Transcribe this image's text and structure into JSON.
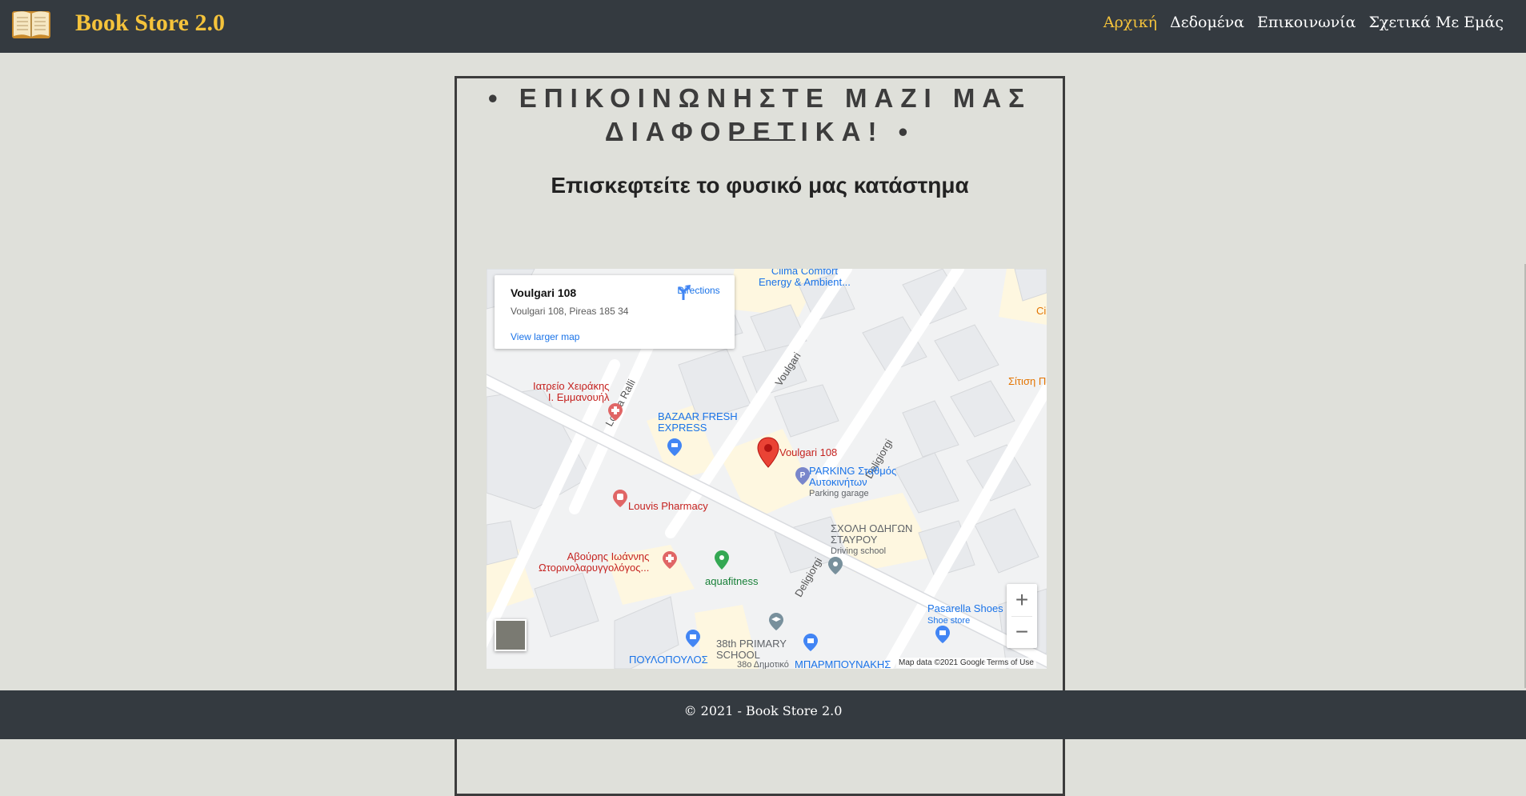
{
  "nav": {
    "brand": "Book Store 2.0",
    "links": [
      "Αρχική",
      "Δεδομένα",
      "Επικοινωνία",
      "Σχετικά Με Εμάς"
    ],
    "active": "Αρχική"
  },
  "contact": {
    "heading_line1": "• ΕΠΙΚΟΙΝΩΝΗΣΤΕ ΜΑΖΙ ΜΑΣ",
    "heading_line2": "ΔΙΑΦΟΡΕΤΙΚΑ! •",
    "subheading": "Επισκεφτείτε το φυσικό μας κατάστημα"
  },
  "map": {
    "card": {
      "title": "Voulgari 108",
      "address": "Voulgari 108, Pireas 185 34",
      "directions": "Directions",
      "larger_map": "View larger map"
    },
    "marker_label": "Voulgari 108",
    "streets": [
      "Voulgari",
      "Louka Ralli",
      "Deligiorgi",
      "Deligiorgi"
    ],
    "places": [
      {
        "name": "Ιατρείο Χειράκης\nΙ. Εμμανουήλ",
        "color": "#c5221f"
      },
      {
        "name": "BAZAAR FRESH\nEXPRESS",
        "color": "#1a73e8"
      },
      {
        "name": "PARKING Σταθμός\nΑυτοκινήτων",
        "color": "#1a73e8"
      },
      {
        "name": "Parking garage",
        "color": "#5f6368"
      },
      {
        "name": "Louvis Pharmacy",
        "color": "#c5221f"
      },
      {
        "name": "ΣΧΟΛΗ ΟΔΗΓΩΝ\nΣΤΑΥΡΟΥ",
        "color": "#5f6368"
      },
      {
        "name": "Driving school",
        "color": "#5f6368"
      },
      {
        "name": "Αβούρης Ιωάννης\nΩτορινολαρυγγολόγος...",
        "color": "#c5221f"
      },
      {
        "name": "aquafitness",
        "color": "#188038"
      },
      {
        "name": "Pasarella Shoes",
        "color": "#1a73e8"
      },
      {
        "name": "Shoe store",
        "color": "#1a73e8"
      },
      {
        "name": "38th PRIMARY\nSCHOOL",
        "color": "#5f6368"
      },
      {
        "name": "38ο Δημοτικό",
        "color": "#5f6368"
      },
      {
        "name": "ΠΟΥΛΟΠΟΥΛΟΣ",
        "color": "#1a73e8"
      },
      {
        "name": "ΜΠΑΡΜΠΟΥΝΑΚΗΣ",
        "color": "#1a73e8"
      },
      {
        "name": "Clima Comfort\nEnergy & Ambient...",
        "color": "#1a73e8"
      },
      {
        "name": "Σίτιση Π",
        "color": "#e37400"
      },
      {
        "name": "Ci",
        "color": "#e37400"
      }
    ],
    "zoom_in": "+",
    "zoom_out": "−",
    "attribution_data": "Map data ©2021 Google",
    "attribution_terms": "Terms of Use"
  },
  "footer": {
    "text": "© 2021 - Book Store 2.0"
  }
}
